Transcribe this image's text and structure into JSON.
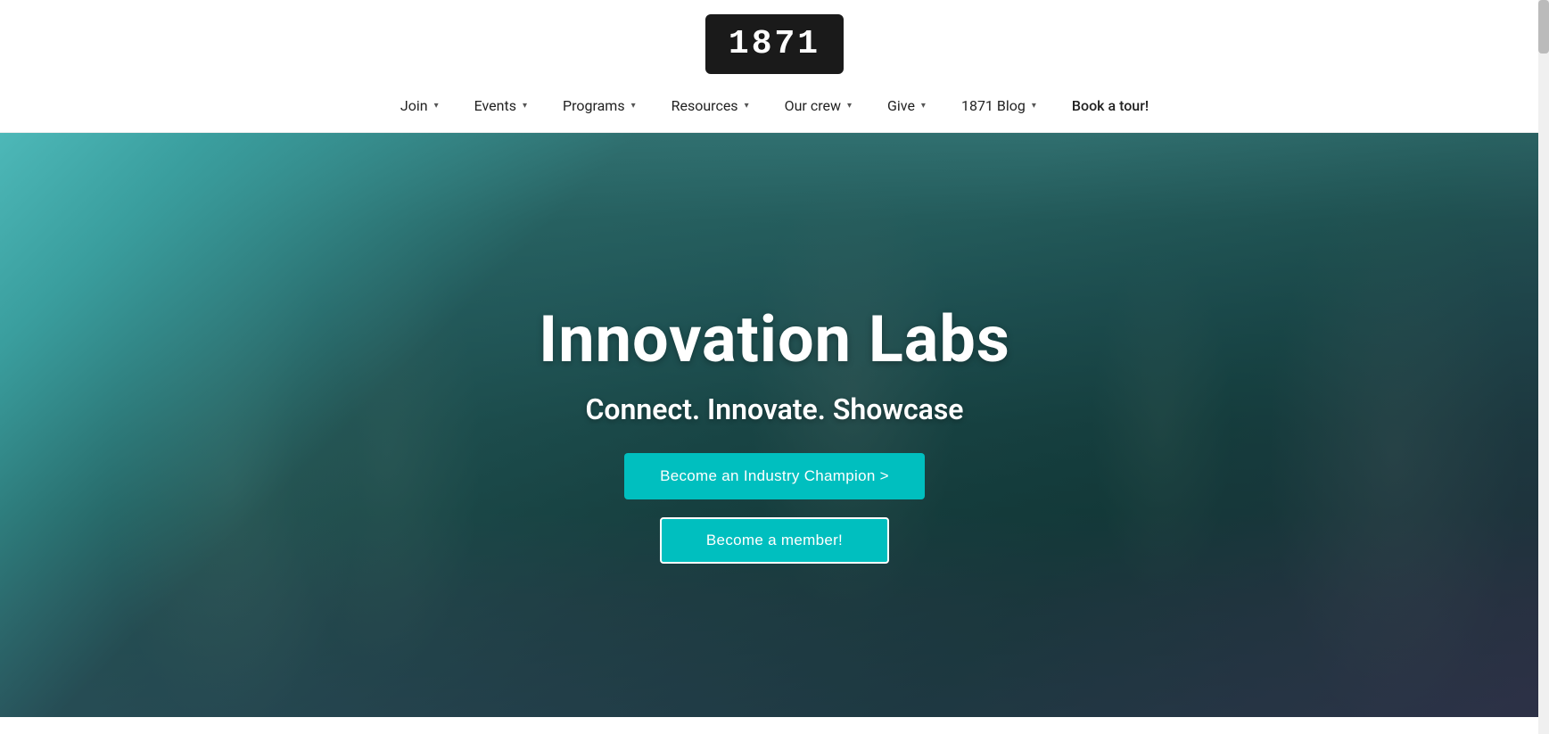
{
  "header": {
    "logo_text": "1871",
    "nav_items": [
      {
        "label": "Join",
        "has_dropdown": true,
        "id": "join"
      },
      {
        "label": "Events",
        "has_dropdown": true,
        "id": "events"
      },
      {
        "label": "Programs",
        "has_dropdown": true,
        "id": "programs"
      },
      {
        "label": "Resources",
        "has_dropdown": true,
        "id": "resources"
      },
      {
        "label": "Our crew",
        "has_dropdown": true,
        "id": "our-crew"
      },
      {
        "label": "Give",
        "has_dropdown": true,
        "id": "give"
      },
      {
        "label": "1871 Blog",
        "has_dropdown": true,
        "id": "blog"
      },
      {
        "label": "Book a tour!",
        "has_dropdown": false,
        "id": "book-tour"
      }
    ]
  },
  "hero": {
    "title": "Innovation Labs",
    "subtitle": "Connect. Innovate. Showcase",
    "btn_champion_label": "Become an Industry Champion >",
    "btn_member_label": "Become a member!"
  },
  "colors": {
    "accent": "#00bfbf",
    "logo_bg": "#1a1a1a",
    "text_dark": "#222222"
  }
}
